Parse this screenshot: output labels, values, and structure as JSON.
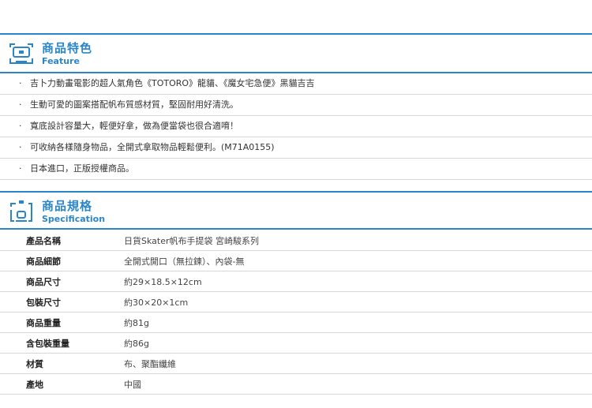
{
  "feature": {
    "title_cn": "商品特色",
    "title_en": "Feature",
    "icon": "camera-frame-icon",
    "items": [
      "吉卜力動畫電影的超人氣角色《TOTORO》龍貓、《魔女宅急便》黑貓吉吉",
      "生動可愛的圖案搭配帆布質感材質，堅固耐用好清洗。",
      "寬底設計容量大，輕便好拿，做為便當袋也很合適唷！",
      "可收納各樣隨身物品，全開式拿取物品輕鬆便利。(M71A0155)",
      "日本進口，正版授權商品。"
    ]
  },
  "spec": {
    "title_cn": "商品規格",
    "title_en": "Specification",
    "icon": "phone-frame-icon",
    "rows": [
      {
        "label": "產品名稱",
        "value": "日貨Skater帆布手提袋 宮崎駿系列"
      },
      {
        "label": "商品細節",
        "value": "全開式開口（無拉鍊）、內袋-無"
      },
      {
        "label": "商品尺寸",
        "value": "約29×18.5×12cm"
      },
      {
        "label": "包裝尺寸",
        "value": "約30×20×1cm"
      },
      {
        "label": "商品重量",
        "value": "約81g"
      },
      {
        "label": "含包裝重量",
        "value": "約86g"
      },
      {
        "label": "材質",
        "value": "布、聚酯纖維"
      },
      {
        "label": "產地",
        "value": "中國"
      }
    ]
  },
  "colors": {
    "accent": "#2a86c8",
    "divider": "#d6d6d6"
  }
}
